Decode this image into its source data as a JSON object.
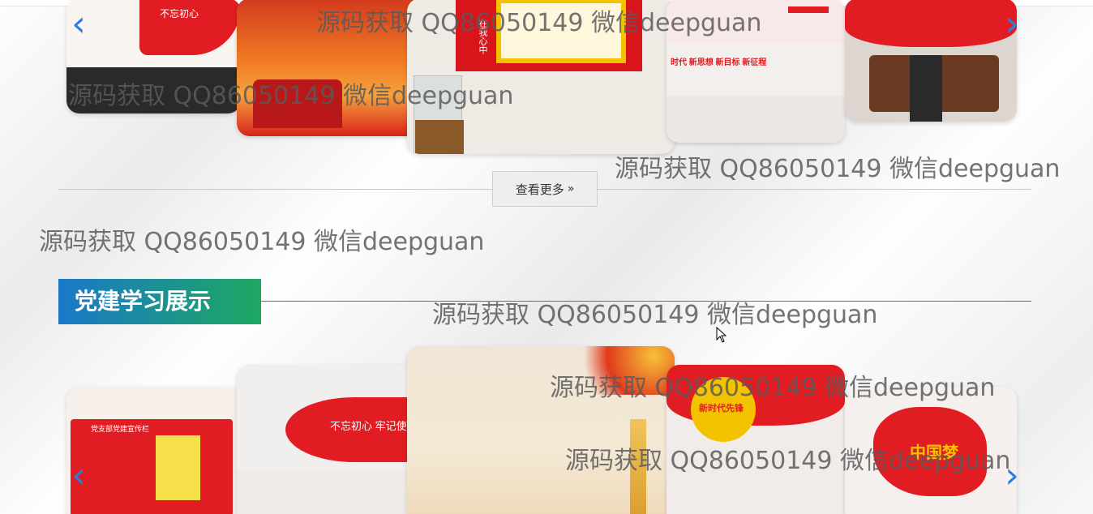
{
  "watermark": "源码获取 QQ86050149 微信deepguan",
  "more_button": {
    "label": "查看更多",
    "icon": "double-chevron-right-icon"
  },
  "section": {
    "title": "党建学习展示"
  },
  "carousel_top": {
    "arrow_prev": "‹",
    "arrow_next": "›",
    "cards": [
      {
        "name": "party-wall-red-flag",
        "text": "不忘初心"
      },
      {
        "name": "tiananmen-orange",
        "text": ""
      },
      {
        "name": "exhibit-display-case",
        "text": "在我心中"
      },
      {
        "name": "new-era-wall",
        "text": "时代  新思想  新目标  新征程"
      },
      {
        "name": "meeting-room",
        "text": ""
      }
    ]
  },
  "carousel_bottom": {
    "arrow_prev": "‹",
    "arrow_next": "›",
    "cards": [
      {
        "name": "party-branch-board",
        "text": "党支部党建宣传栏"
      },
      {
        "name": "red-ribbon-wall",
        "text": "不忘初心 牢记使命"
      },
      {
        "name": "huabiao-background",
        "text": ""
      },
      {
        "name": "new-era-pioneer",
        "text": "新时代先锋"
      },
      {
        "name": "china-map-wall",
        "text": "中国梦"
      }
    ]
  },
  "colors": {
    "accent_blue": "#1b78c9",
    "accent_green": "#1ea860",
    "party_red": "#d9141b",
    "arrow_blue": "#2a7de1"
  }
}
